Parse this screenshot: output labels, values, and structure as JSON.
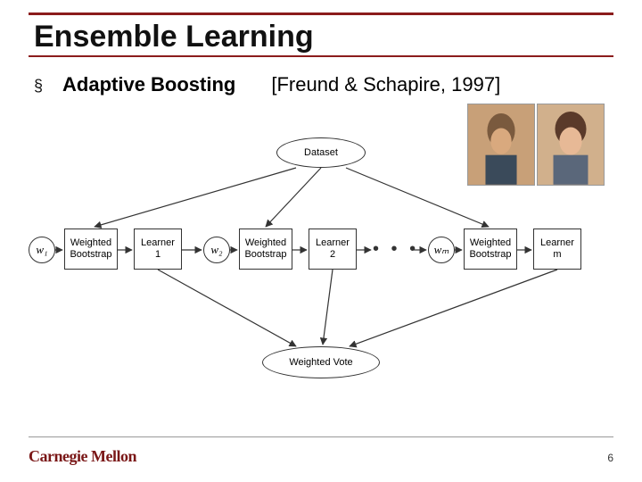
{
  "slide": {
    "title": "Ensemble Learning",
    "bullet_marker": "§",
    "topic": "Adaptive Boosting",
    "citation": "[Freund & Schapire, 1997]",
    "page_number": "6",
    "logo_text": "Carnegie Mellon"
  },
  "diagram": {
    "dataset": "Dataset",
    "weighted_bootstrap": "Weighted\nBootstrap",
    "learners": [
      "Learner\n1",
      "Learner\n2",
      "Learner\nm"
    ],
    "weights": [
      "w₁",
      "w₂",
      "wₘ"
    ],
    "ellipsis": "• • •",
    "output": "Weighted Vote"
  },
  "photos": {
    "person1_alt": "Yoav Freund photo",
    "person2_alt": "Robert Schapire photo"
  }
}
